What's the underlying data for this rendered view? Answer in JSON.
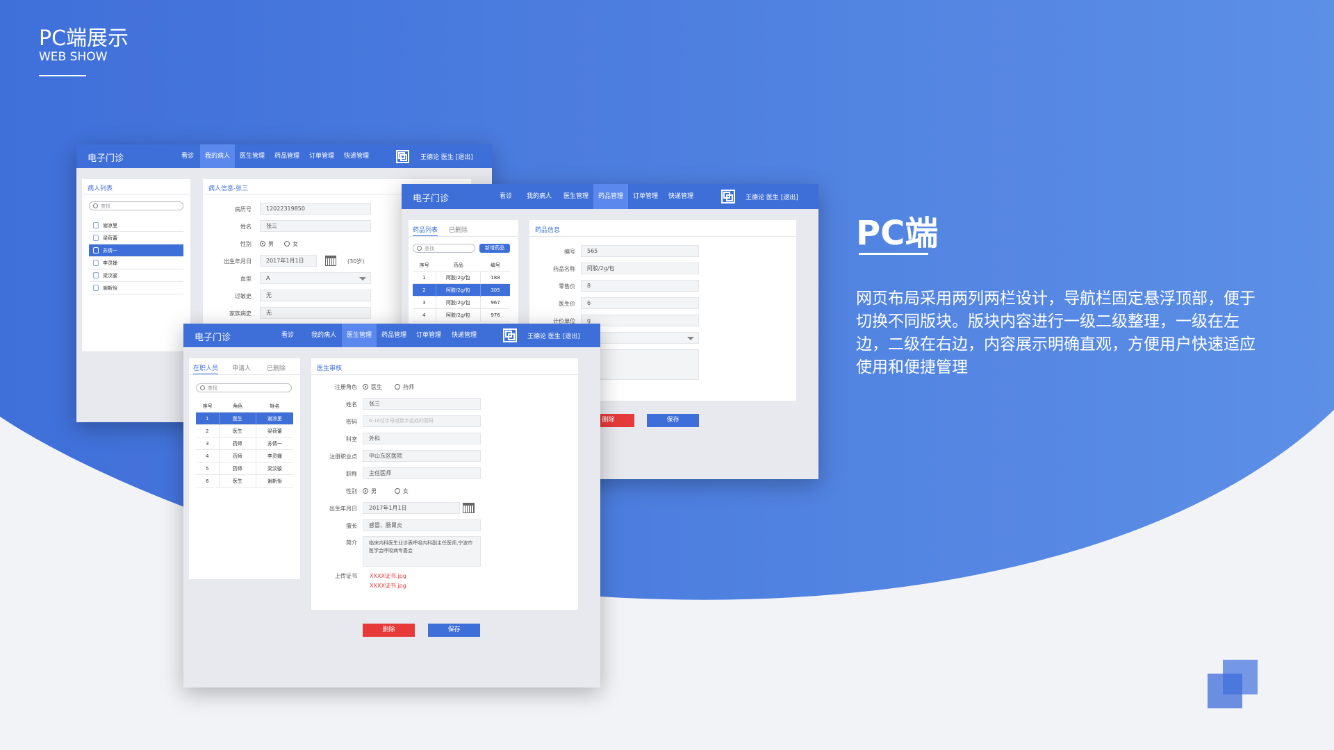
{
  "header": {
    "title": "PC端展示",
    "subtitle": "WEB SHOW"
  },
  "right": {
    "title": "PC端",
    "description": "网页布局采用两列两栏设计，导航栏固定悬浮顶部，便于切换不同版块。版块内容进行一级二级整理，一级在左边，二级在右边，内容展示明确直观，方便用户快速适应使用和便捷管理"
  },
  "colors": {
    "primary": "#3e6fd8",
    "danger": "#e63a3a",
    "background": "#f2f3f7"
  },
  "brand": "电子门诊",
  "user": "王德论  医生  [退出]",
  "nav": [
    "看诊",
    "我的病人",
    "医生管理",
    "药品管理",
    "订单管理",
    "快递管理"
  ],
  "icons": {
    "qr": "qr-code-icon",
    "search": "search-icon",
    "calendar": "calendar-icon",
    "patient": "person-icon",
    "dropdown": "chevron-down-icon"
  },
  "win1": {
    "active_nav": "我的病人",
    "left_tab": "病人列表",
    "search_placeholder": "查找",
    "patients": [
      "谢凉里",
      "梁荷蕾",
      "苏倩一",
      "李灵姗",
      "梁汶骏",
      "谢新怡"
    ],
    "selected_index": 2,
    "right_title": "病人信息-张三",
    "fields": {
      "record_no_label": "病历号",
      "record_no": "12022319850",
      "name_label": "姓名",
      "name": "张三",
      "gender_label": "性别",
      "male": "男",
      "female": "女",
      "birth_label": "出生年月日",
      "birth": "2017年1月1日",
      "age": "(30岁)",
      "blood_label": "血型",
      "blood": "A",
      "allergy_label": "过敏史",
      "allergy": "无",
      "family_label": "家族病史",
      "family": "无"
    }
  },
  "win2": {
    "active_nav": "药品管理",
    "tab_list": "药品列表",
    "tab_deleted": "已删除",
    "search_placeholder": "查找",
    "add_button": "新增药品",
    "table_head": [
      "序号",
      "药品",
      "编号"
    ],
    "rows": [
      [
        "1",
        "阿胶/2g/包",
        "188"
      ],
      [
        "2",
        "阿胶/2g/包",
        "305"
      ],
      [
        "3",
        "阿胶/2g/包",
        "967"
      ],
      [
        "4",
        "阿胶/2g/包",
        "976"
      ]
    ],
    "selected_index": 1,
    "right_title": "药品信息",
    "fields": {
      "code_label": "编号",
      "code": "565",
      "drug_name_label": "药品名称",
      "drug_name": "阿胶/2g/包",
      "retail_label": "零售价",
      "retail": "8",
      "doctor_price_label": "医生价",
      "doctor_price": "6",
      "unit_label": "计价单位",
      "unit": "g"
    },
    "delete": "删除",
    "save": "保存"
  },
  "win3": {
    "active_nav": "医生管理",
    "tabs": [
      "在职人员",
      "申请人",
      "已删除"
    ],
    "search_placeholder": "查找",
    "table_head": [
      "序号",
      "角色",
      "姓名"
    ],
    "rows": [
      [
        "1",
        "医生",
        "谢凉里"
      ],
      [
        "2",
        "医生",
        "梁荷蕾"
      ],
      [
        "3",
        "药师",
        "苏倩一"
      ],
      [
        "4",
        "药师",
        "李灵姗"
      ],
      [
        "5",
        "药师",
        "梁汶骏"
      ],
      [
        "6",
        "医生",
        "谢新怡"
      ]
    ],
    "selected_index": 0,
    "right_title": "医生审核",
    "fields": {
      "role_label": "注册角色",
      "role_doctor": "医生",
      "role_pharmacist": "药师",
      "name_label": "姓名",
      "name": "张三",
      "password_label": "密码",
      "password_placeholder": "6-16位字母或数字组成的密码",
      "dept_label": "科室",
      "dept": "外科",
      "practice_label": "注册职业点",
      "practice": "中山东区医院",
      "title_label": "职称",
      "title": "主任医师",
      "gender_label": "性别",
      "male": "男",
      "female": "女",
      "birth_label": "出生年月日",
      "birth": "2017年1月1日",
      "specialty_label": "擅长",
      "specialty": "感冒、肠胃炎",
      "intro_label": "简介",
      "intro": "临床内科医生业诊表呼吸内科副主任医师,宁波市医学会呼吸病专委会",
      "cert_label": "上传证书",
      "cert1": "XXXX证书.jpg",
      "cert2": "XXXX证书.jpg"
    },
    "delete": "删除",
    "save": "保存"
  }
}
